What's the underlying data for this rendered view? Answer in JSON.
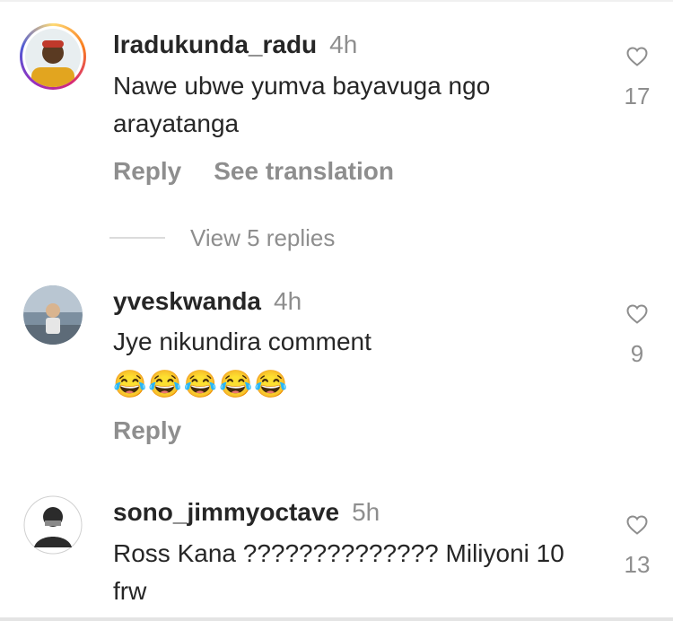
{
  "comments": [
    {
      "username": "lradukunda_radu",
      "time": "4h",
      "text": "Nawe ubwe yumva bayavuga ngo arayatanga",
      "likes": "17",
      "actions": [
        "Reply",
        "See translation"
      ],
      "view_replies": "View 5 replies"
    },
    {
      "username": "yveskwanda",
      "time": "4h",
      "text": "Jye nikundira comment",
      "emoji": "😂😂😂😂😂",
      "likes": "9",
      "actions": [
        "Reply"
      ]
    },
    {
      "username": "sono_jimmyoctave",
      "time": "5h",
      "text": "Ross Kana ?????????????? Miliyoni 10 frw",
      "likes": "13"
    }
  ],
  "icons": {
    "like": "heart-outline-icon"
  },
  "colors": {
    "primary_text": "#262626",
    "secondary_text": "#8e8e8e",
    "divider": "#dbdbdb"
  }
}
